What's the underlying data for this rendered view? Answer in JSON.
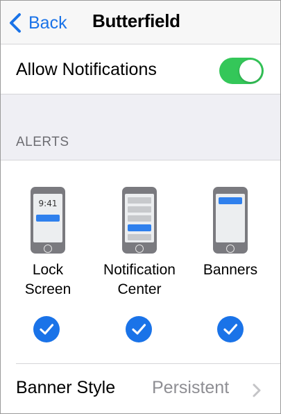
{
  "nav": {
    "back_label": "Back",
    "title": "Butterfield"
  },
  "allow": {
    "label": "Allow Notifications",
    "enabled": true
  },
  "alerts": {
    "header": "ALERTS",
    "options": [
      {
        "line1": "Lock",
        "line2": "Screen",
        "time": "9:41",
        "checked": true
      },
      {
        "line1": "Notification",
        "line2": "Center",
        "checked": true
      },
      {
        "line1": "Banners",
        "line2": "",
        "checked": true
      }
    ]
  },
  "banner_style": {
    "label": "Banner Style",
    "value": "Persistent"
  },
  "colors": {
    "accent": "#1a73e8",
    "toggle_on": "#34c759",
    "secondary_text": "#8e8e93"
  },
  "icons": {
    "back": "chevron-left-icon",
    "check": "checkmark-icon",
    "disclosure": "chevron-right-icon"
  }
}
